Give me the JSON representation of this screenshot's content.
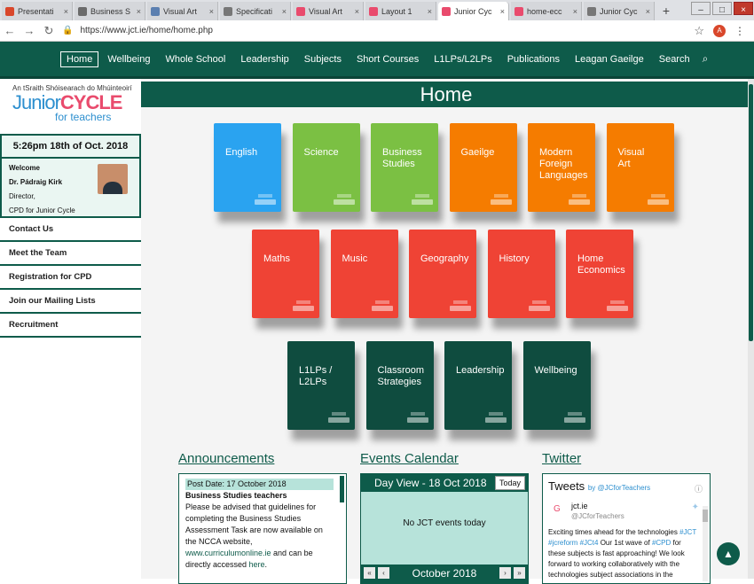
{
  "browser": {
    "tabs": [
      {
        "label": "Presentati",
        "color": "#d9472b",
        "icon": "gmail-icon"
      },
      {
        "label": "Business S",
        "color": "#6b6b6b",
        "icon": "c-icon"
      },
      {
        "label": "Visual Art",
        "color": "#5b7fb0",
        "icon": "image-icon"
      },
      {
        "label": "Specificati",
        "color": "#777777",
        "icon": "doc-icon"
      },
      {
        "label": "Visual Art",
        "color": "#e94b6d",
        "icon": "g-icon"
      },
      {
        "label": "Layout 1",
        "color": "#e94b6d",
        "icon": "g-icon"
      },
      {
        "label": "Junior Cyc",
        "color": "#e94b6d",
        "icon": "g-icon",
        "active": true
      },
      {
        "label": "home-ecc",
        "color": "#e94b6d",
        "icon": "g-icon"
      },
      {
        "label": "Junior Cyc",
        "color": "#777777",
        "icon": "doc-icon"
      }
    ],
    "url": "https://www.jct.ie/home/home.php",
    "avatar_letter": "A"
  },
  "nav": {
    "items": [
      "Home",
      "Wellbeing",
      "Whole School",
      "Leadership",
      "Subjects",
      "Short Courses",
      "L1LPs/L2LPs",
      "Publications",
      "Leagan Gaeilge",
      "Search"
    ],
    "active": "Home"
  },
  "sidebar": {
    "irish_line": "An tSraith Shóisearach do Mhúinteoirí",
    "brand_junior": "Junior",
    "brand_cycle": "CYCLE",
    "brand_sub": "for teachers",
    "datetime": "5:26pm  18th of Oct. 2018",
    "welcome": "Welcome",
    "name": "Dr. Pádraig Kirk",
    "role": "Director,",
    "role2": "CPD for Junior Cycle",
    "links": [
      "Contact Us",
      "Meet the Team",
      "Registration for CPD",
      "Join our Mailing Lists",
      "Recruitment"
    ]
  },
  "main": {
    "title": "Home",
    "rows": [
      [
        {
          "label": "English",
          "color": "#2aa3f0"
        },
        {
          "label": "Science",
          "color": "#7bc043"
        },
        {
          "label": "Business\nStudies",
          "color": "#7bc043"
        },
        {
          "label": "Gaeilge",
          "color": "#f57c00"
        },
        {
          "label": "Modern\nForeign\nLanguages",
          "color": "#f57c00"
        },
        {
          "label": "Visual\nArt",
          "color": "#f57c00"
        }
      ],
      [
        {
          "label": "Maths",
          "color": "#ef4335"
        },
        {
          "label": "Music",
          "color": "#ef4335"
        },
        {
          "label": "Geography",
          "color": "#ef4335"
        },
        {
          "label": "History",
          "color": "#ef4335"
        },
        {
          "label": "Home\nEconomics",
          "color": "#ef4335"
        }
      ],
      [
        {
          "label": "L1LPs /\nL2LPs",
          "color": "#0f4c3f"
        },
        {
          "label": "Classroom\nStrategies",
          "color": "#0f4c3f"
        },
        {
          "label": "Leadership",
          "color": "#0f4c3f"
        },
        {
          "label": "Wellbeing",
          "color": "#0f4c3f"
        }
      ]
    ],
    "announcements": {
      "heading": "Announcements",
      "post_date": "Post Date: 17 October 2018",
      "post_title": "Business Studies teachers",
      "body1": "Please be advised that guidelines for completing the Business Studies Assessment Task are now available on the NCCA website, ",
      "link": "www.curriculumonline.ie",
      "body2": " and can be directly accessed ",
      "here": "here",
      "end": "."
    },
    "events": {
      "heading": "Events Calendar",
      "day_view": "Day View - 18 Oct 2018",
      "today": "Today",
      "empty": "No JCT events today",
      "month": "October 2018",
      "prev2": "«",
      "prev": "‹",
      "next": "›",
      "next2": "»"
    },
    "twitter": {
      "heading": "Twitter",
      "tweets_title": "Tweets",
      "by": "by @JCforTeachers",
      "account": "jct.ie",
      "handle": "@JCforTeachers",
      "text_pre": "Exciting times ahead for the technologies ",
      "tags1": "#JCT #jcreform #JCt4",
      "text_mid": " Our 1st wave of ",
      "tag2": "#CPD",
      "text_end": " for these subjects is fast approaching! We look forward to working collaboratively with the technologies subject associations in the"
    }
  }
}
